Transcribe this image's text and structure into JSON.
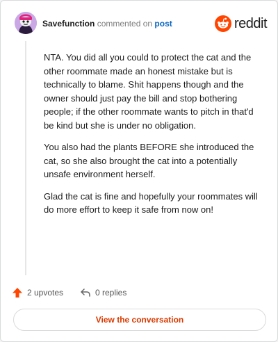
{
  "header": {
    "username": "Savefunction",
    "verb": " commented on ",
    "target": "post",
    "brand": "reddit"
  },
  "comment": {
    "paragraphs": [
      "NTA. You did all you could to protect the cat and the other roommate made an honest mistake but is technically to blame. Shit happens though and the owner should just pay the bill and stop bothering people; if the other roommate wants to pitch in that'd be kind but she is under no obligation.",
      "You also had the plants BEFORE she introduced the cat, so she also brought the cat into a potentially unsafe environment herself.",
      "Glad the cat is fine and hopefully your roommates will do more effort to keep it safe from now on!"
    ]
  },
  "actions": {
    "upvotes_label": "2 upvotes",
    "replies_label": "0 replies"
  },
  "cta": {
    "label": "View the conversation"
  },
  "colors": {
    "brand_orange": "#ff4500",
    "link_blue": "#0a66c2",
    "cta_text": "#d93a00"
  }
}
